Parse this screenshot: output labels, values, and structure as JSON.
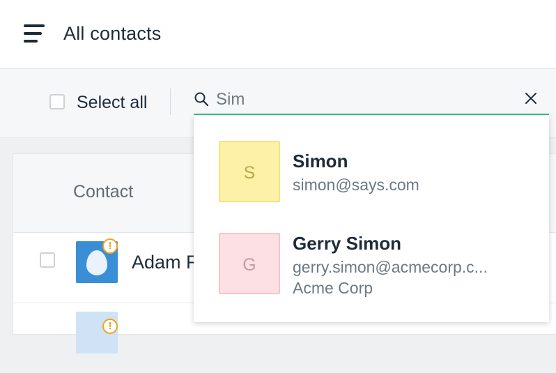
{
  "header": {
    "title": "All contacts"
  },
  "toolbar": {
    "select_all_label": "Select all"
  },
  "search": {
    "value": "Sim"
  },
  "table": {
    "column_contact": "Contact",
    "rows": [
      {
        "name": "Adam R"
      }
    ]
  },
  "results": [
    {
      "initial": "S",
      "name": "Simon",
      "email": "simon@says.com",
      "company": "",
      "avatar_bg": "#fdf1a8",
      "avatar_border": "#f5e37a",
      "avatar_fg": "#b7a84f"
    },
    {
      "initial": "G",
      "name": "Gerry Simon",
      "email": "gerry.simon@acmecorp.c...",
      "company": "Acme Corp",
      "avatar_bg": "#fde0e4",
      "avatar_border": "#f8c3cb",
      "avatar_fg": "#c99aa1"
    }
  ],
  "colors": {
    "accent": "#3dbb86",
    "warning": "#f0a51c",
    "avatar_blue": "#3a8ed6"
  }
}
